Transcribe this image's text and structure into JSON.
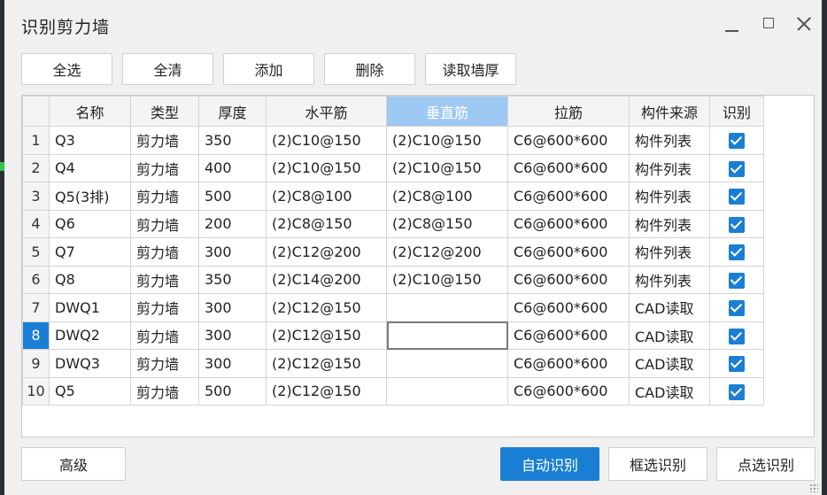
{
  "window": {
    "title": "识别剪力墙"
  },
  "toolbar": [
    {
      "id": "select-all",
      "label": "全选"
    },
    {
      "id": "clear-all",
      "label": "全清"
    },
    {
      "id": "add",
      "label": "添加"
    },
    {
      "id": "delete",
      "label": "删除"
    },
    {
      "id": "read-thickness",
      "label": "读取墙厚"
    }
  ],
  "table": {
    "columns": [
      "名称",
      "类型",
      "厚度",
      "水平筋",
      "垂直筋",
      "拉筋",
      "构件来源",
      "识别"
    ],
    "selected_column": "垂直筋",
    "active_row": 8,
    "rows": [
      {
        "n": "1",
        "name": "Q3",
        "type": "剪力墙",
        "thickness": "350",
        "horizontal": "(2)C10@150",
        "vertical": "(2)C10@150",
        "tie": "C6@600*600",
        "source": "构件列表",
        "checked": true
      },
      {
        "n": "2",
        "name": "Q4",
        "type": "剪力墙",
        "thickness": "400",
        "horizontal": "(2)C10@150",
        "vertical": "(2)C10@150",
        "tie": "C6@600*600",
        "source": "构件列表",
        "checked": true
      },
      {
        "n": "3",
        "name": "Q5(3排)",
        "type": "剪力墙",
        "thickness": "500",
        "horizontal": "(2)C8@100",
        "vertical": "(2)C8@100",
        "tie": "C6@600*600",
        "source": "构件列表",
        "checked": true
      },
      {
        "n": "4",
        "name": "Q6",
        "type": "剪力墙",
        "thickness": "200",
        "horizontal": "(2)C8@150",
        "vertical": "(2)C8@150",
        "tie": "C6@600*600",
        "source": "构件列表",
        "checked": true
      },
      {
        "n": "5",
        "name": "Q7",
        "type": "剪力墙",
        "thickness": "300",
        "horizontal": "(2)C12@200",
        "vertical": "(2)C12@200",
        "tie": "C6@600*600",
        "source": "构件列表",
        "checked": true
      },
      {
        "n": "6",
        "name": "Q8",
        "type": "剪力墙",
        "thickness": "350",
        "horizontal": "(2)C14@200",
        "vertical": "(2)C10@150",
        "tie": "C6@600*600",
        "source": "构件列表",
        "checked": true
      },
      {
        "n": "7",
        "name": "DWQ1",
        "type": "剪力墙",
        "thickness": "300",
        "horizontal": "(2)C12@150",
        "vertical": "",
        "tie": "C6@600*600",
        "source": "CAD读取",
        "checked": true
      },
      {
        "n": "8",
        "name": "DWQ2",
        "type": "剪力墙",
        "thickness": "300",
        "horizontal": "(2)C12@150",
        "vertical": "",
        "tie": "C6@600*600",
        "source": "CAD读取",
        "checked": true
      },
      {
        "n": "9",
        "name": "DWQ3",
        "type": "剪力墙",
        "thickness": "300",
        "horizontal": "(2)C12@150",
        "vertical": "",
        "tie": "C6@600*600",
        "source": "CAD读取",
        "checked": true
      },
      {
        "n": "10",
        "name": "Q5",
        "type": "剪力墙",
        "thickness": "500",
        "horizontal": "(2)C12@150",
        "vertical": "",
        "tie": "C6@600*600",
        "source": "CAD读取",
        "checked": true
      }
    ]
  },
  "footer": {
    "advanced": "高级",
    "auto_identify": "自动识别",
    "box_identify": "框选识别",
    "point_identify": "点选识别"
  },
  "colors": {
    "accent": "#1a7fd4",
    "selected_header": "#9ec9f3"
  }
}
